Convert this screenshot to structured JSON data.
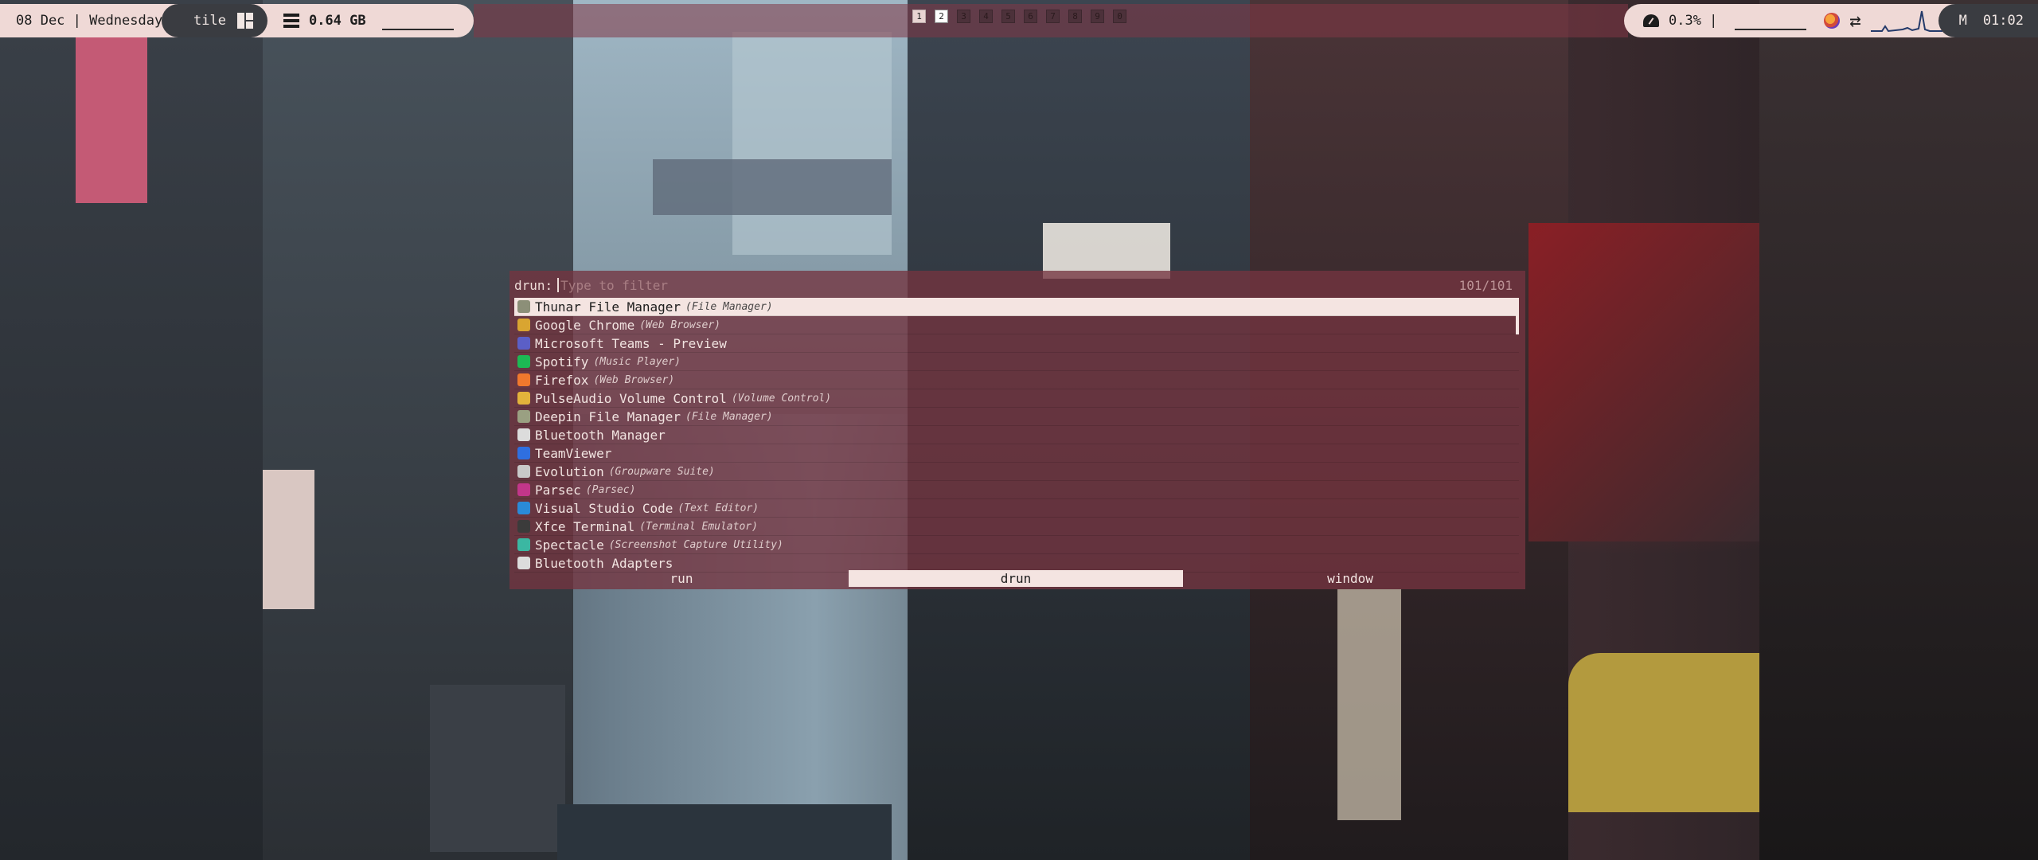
{
  "topbar": {
    "date": "08 Dec | Wednesday",
    "layout": "tile",
    "memory": "0.64 GB",
    "workspaces": [
      {
        "n": "1",
        "state": "occupied"
      },
      {
        "n": "2",
        "state": "active"
      },
      {
        "n": "3",
        "state": "empty"
      },
      {
        "n": "4",
        "state": "empty"
      },
      {
        "n": "5",
        "state": "empty"
      },
      {
        "n": "6",
        "state": "empty"
      },
      {
        "n": "7",
        "state": "empty"
      },
      {
        "n": "8",
        "state": "empty"
      },
      {
        "n": "9",
        "state": "empty"
      },
      {
        "n": "0",
        "state": "empty"
      }
    ],
    "cpu": "0.3% |",
    "mode_letter": "M",
    "time": "01:02"
  },
  "rofi": {
    "prompt": "drun:",
    "placeholder": "Type to filter",
    "count": "101/101",
    "entries": [
      {
        "name": "Thunar File Manager",
        "generic": "(File Manager)",
        "icon": "folder-icon",
        "color": "#8c8f78"
      },
      {
        "name": "Google Chrome",
        "generic": "(Web Browser)",
        "icon": "chrome-icon",
        "color": "#d9a531"
      },
      {
        "name": "Microsoft Teams - Preview",
        "generic": "",
        "icon": "teams-icon",
        "color": "#5b5fc7"
      },
      {
        "name": "Spotify",
        "generic": "(Music Player)",
        "icon": "spotify-icon",
        "color": "#1db954"
      },
      {
        "name": "Firefox",
        "generic": "(Web Browser)",
        "icon": "firefox-icon",
        "color": "#f0782d"
      },
      {
        "name": "PulseAudio Volume Control",
        "generic": "(Volume Control)",
        "icon": "volume-icon",
        "color": "#e3b33b"
      },
      {
        "name": "Deepin File Manager",
        "generic": "(File Manager)",
        "icon": "folder-icon",
        "color": "#9aa082"
      },
      {
        "name": "Bluetooth Manager",
        "generic": "",
        "icon": "bluetooth-icon",
        "color": "#dcdcdc"
      },
      {
        "name": "TeamViewer",
        "generic": "",
        "icon": "teamviewer-icon",
        "color": "#2f6fe0"
      },
      {
        "name": "Evolution",
        "generic": "(Groupware Suite)",
        "icon": "evolution-icon",
        "color": "#c9c9c9"
      },
      {
        "name": "Parsec",
        "generic": "(Parsec)",
        "icon": "parsec-icon",
        "color": "#c2368a"
      },
      {
        "name": "Visual Studio Code",
        "generic": "(Text Editor)",
        "icon": "vscode-icon",
        "color": "#2a8ad8"
      },
      {
        "name": "Xfce Terminal",
        "generic": "(Terminal Emulator)",
        "icon": "terminal-icon",
        "color": "#3b3b3b"
      },
      {
        "name": "Spectacle",
        "generic": "(Screenshot Capture Utility)",
        "icon": "camera-icon",
        "color": "#3bb7a2"
      },
      {
        "name": "Bluetooth Adapters",
        "generic": "",
        "icon": "bluetooth-icon",
        "color": "#dcdcdc"
      }
    ],
    "modes": [
      {
        "label": "run",
        "active": false
      },
      {
        "label": "drun",
        "active": true
      },
      {
        "label": "window",
        "active": false
      }
    ]
  }
}
